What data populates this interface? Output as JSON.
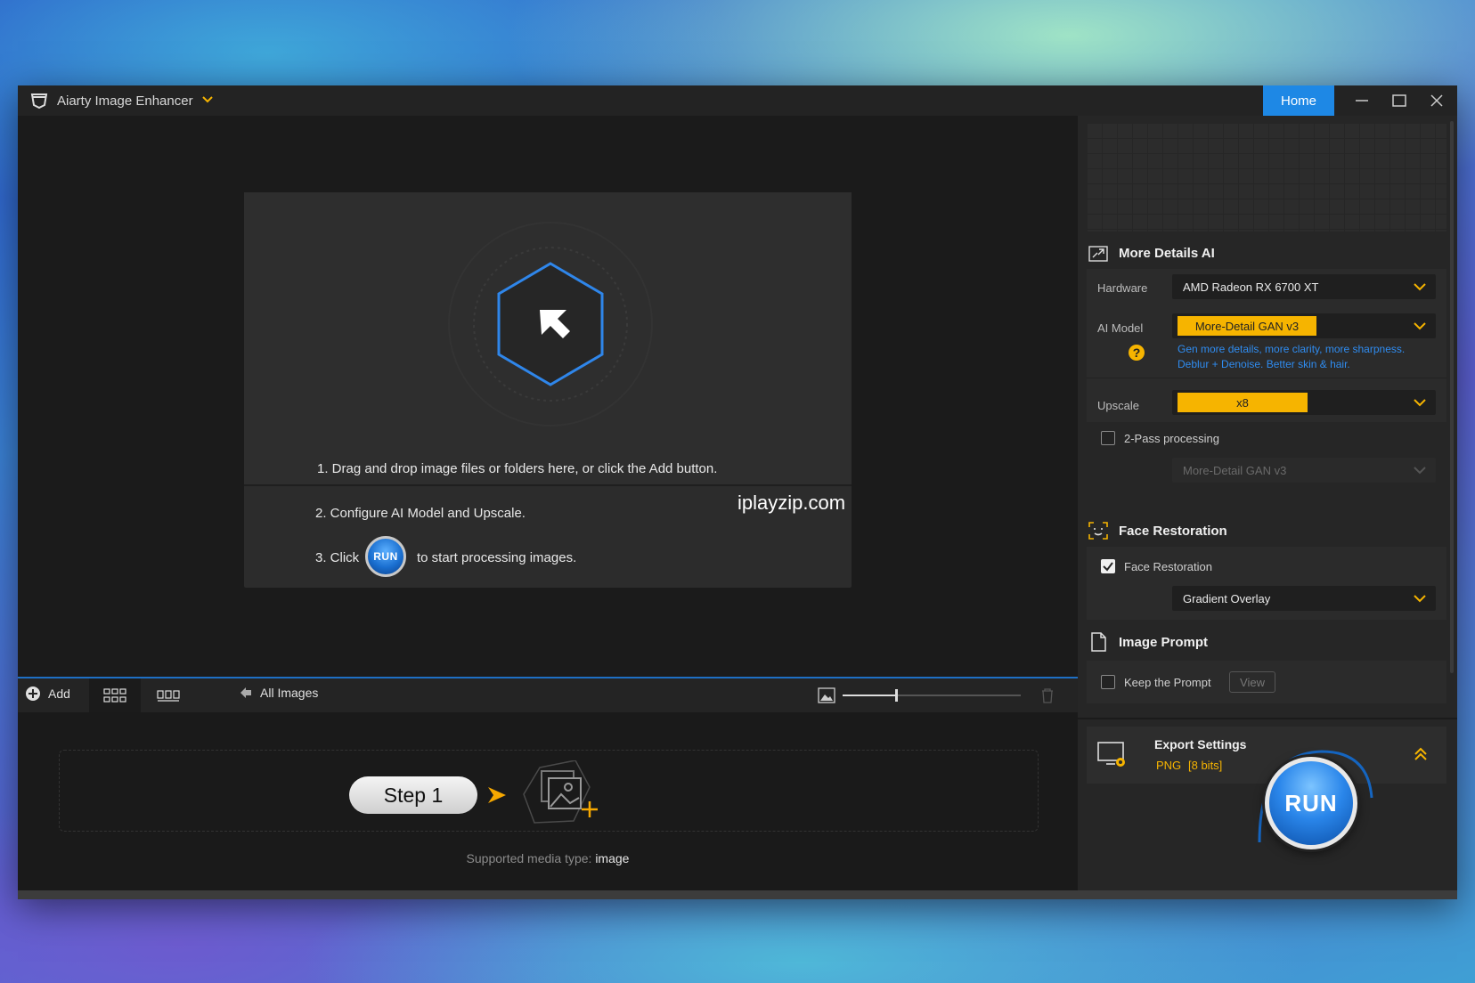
{
  "titlebar": {
    "app_title": "Aiarty Image Enhancer",
    "home_label": "Home"
  },
  "drop_panel": {
    "step1": "1. Drag and drop image files or folders here, or click the Add button.",
    "step2": "2. Configure AI Model and Upscale.",
    "step3_prefix": "3. Click",
    "step3_run": "RUN",
    "step3_suffix": "to start processing images."
  },
  "watermark": "iplayzip.com",
  "toolbar": {
    "add_label": "Add",
    "all_images_label": "All Images",
    "zoom_level": 0.3
  },
  "bottom": {
    "step_label": "Step 1",
    "supported_prefix": "Supported media type:",
    "supported_type": "image"
  },
  "sidebar": {
    "more_details": {
      "title": "More Details AI",
      "hardware_label": "Hardware",
      "hardware_value": "AMD Radeon RX 6700 XT",
      "ai_model_label": "AI Model",
      "ai_model_value": "More-Detail GAN  v3",
      "hint_line1": "Gen more details, more clarity, more sharpness.",
      "hint_line2": "Deblur + Denoise. Better skin & hair.",
      "upscale_label": "Upscale",
      "upscale_value": "x8",
      "two_pass_label": "2-Pass processing",
      "two_pass_checked": false,
      "two_pass_model": "More-Detail GAN  v3"
    },
    "face_restoration": {
      "title": "Face Restoration",
      "checkbox_label": "Face Restoration",
      "checked": true,
      "mode_value": "Gradient Overlay"
    },
    "image_prompt": {
      "title": "Image Prompt",
      "keep_label": "Keep the Prompt",
      "keep_checked": false,
      "view_label": "View"
    },
    "export": {
      "title": "Export Settings",
      "format": "PNG",
      "bits": "[8 bits]"
    },
    "run_label": "RUN"
  },
  "colors": {
    "accent_blue": "#1e88e5",
    "accent_yellow": "#f6b400",
    "hint_blue": "#2f8cf0"
  }
}
